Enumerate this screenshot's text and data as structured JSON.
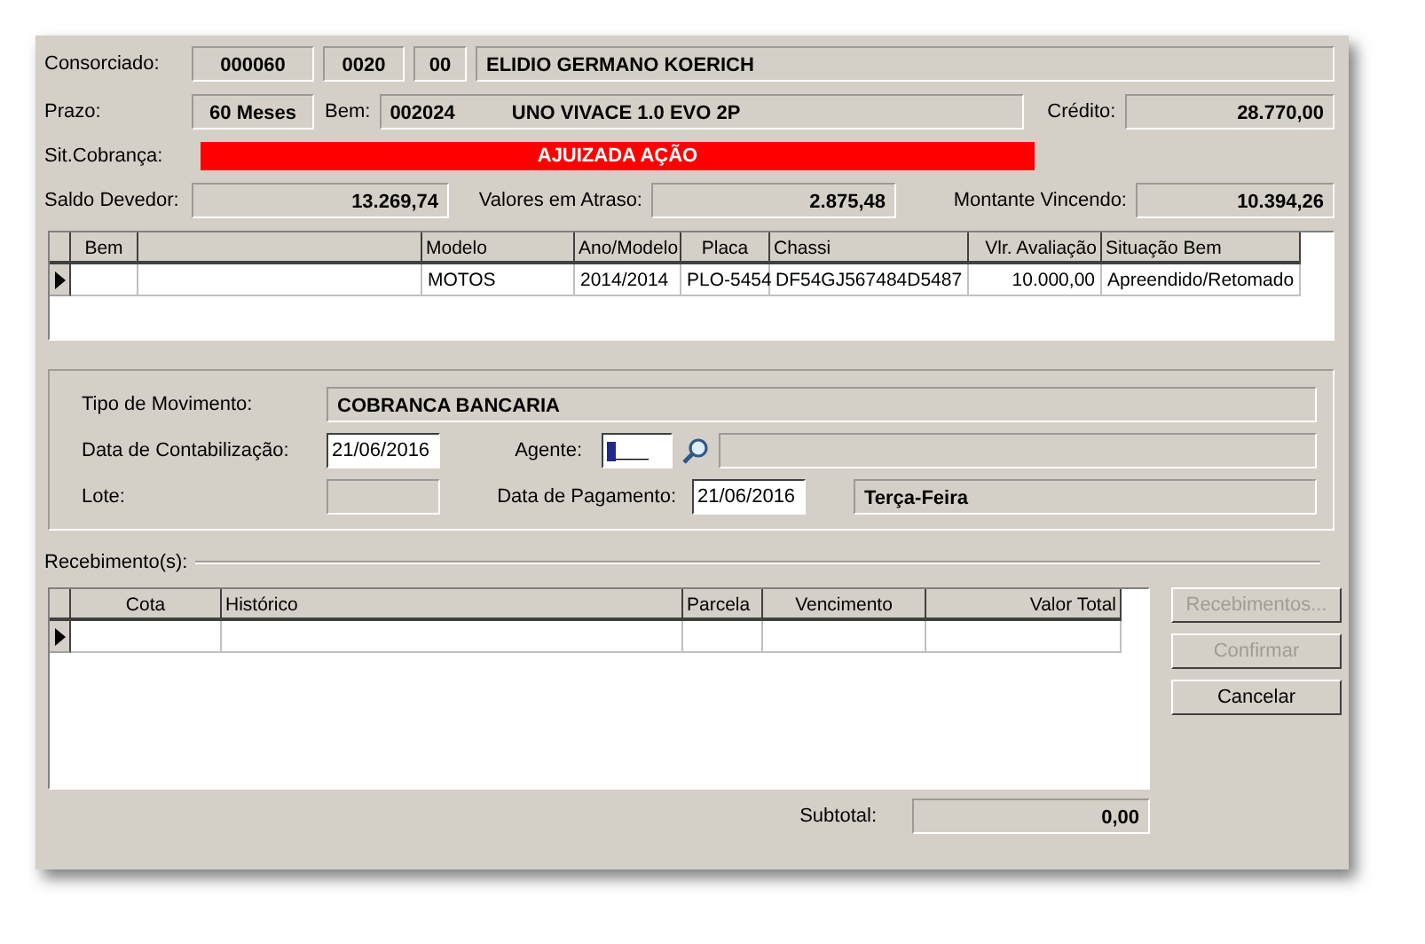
{
  "header": {
    "consorciado_label": "Consorciado:",
    "grupo": "000060",
    "cota": "0020",
    "rd": "00",
    "nome": "ELIDIO GERMANO KOERICH",
    "prazo_label": "Prazo:",
    "prazo": "60 Meses",
    "bem_label": "Bem:",
    "bem_codigo": "002024",
    "bem_descricao": "UNO VIVACE 1.0 EVO 2P",
    "credito_label": "Crédito:",
    "credito": "28.770,00",
    "sit_label": "Sit.Cobrança:",
    "sit": "AJUIZADA AÇÃO",
    "saldo_label": "Saldo Devedor:",
    "saldo": "13.269,74",
    "atraso_label": "Valores em Atraso:",
    "atraso": "2.875,48",
    "vincendo_label": "Montante Vincendo:",
    "vincendo": "10.394,26"
  },
  "bens_table": {
    "columns": [
      "Bem",
      null,
      "Modelo",
      "Ano/Modelo",
      "Placa",
      "Chassi",
      "Vlr. Avaliação",
      "Situação Bem"
    ],
    "rows": [
      {
        "current": true,
        "cells": [
          "",
          "",
          "MOTOS",
          "2014/2014",
          "PLO-5454",
          "DF54GJ567484D5487",
          "10.000,00",
          "Apreendido/Retomado"
        ]
      }
    ]
  },
  "movimento": {
    "tipo_label": "Tipo de Movimento:",
    "tipo": "COBRANCA BANCARIA",
    "data_cont_label": "Data de Contabilização:",
    "data_cont": "21/06/2016",
    "agente_label": "Agente:",
    "agente": "___",
    "lote_label": "Lote:",
    "data_pag_label": "Data de Pagamento:",
    "data_pag": "21/06/2016",
    "dia_semana": "Terça-Feira"
  },
  "recebimentos": {
    "label": "Recebimento(s):",
    "columns": [
      "Cota",
      "Histórico",
      "Parcela",
      "Vencimento",
      "Valor Total"
    ],
    "rows": [
      {
        "current": true
      }
    ],
    "subtotal_label": "Subtotal:",
    "subtotal": "0,00"
  },
  "buttons": [
    {
      "label": "Recebimentos...",
      "disabled": true
    },
    {
      "label": "Confirmar",
      "disabled": true
    },
    {
      "label": "Cancelar",
      "disabled": false
    }
  ]
}
